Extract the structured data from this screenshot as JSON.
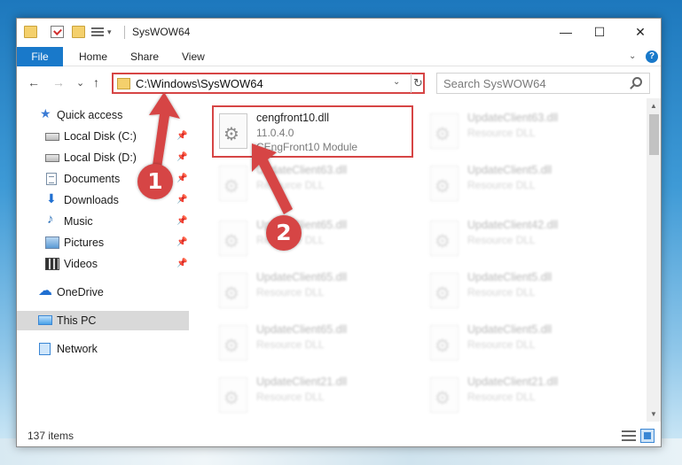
{
  "window": {
    "title": "SysWOW64",
    "controls": {
      "minimize": "—",
      "maximize": "☐",
      "close": "✕"
    }
  },
  "quick_access_toolbar": {
    "items": [
      "folder-icon",
      "properties-icon",
      "new-folder-icon",
      "customize-menu-icon"
    ],
    "dropdown_glyph": "▾"
  },
  "ribbon": {
    "tabs": [
      "File",
      "Home",
      "Share",
      "View"
    ],
    "expand_glyph": "⌄",
    "help_glyph": "?"
  },
  "navigation": {
    "back_glyph": "←",
    "forward_glyph": "→",
    "recent_glyph": "⌄",
    "up_glyph": "↑"
  },
  "address_bar": {
    "path": "C:\\Windows\\SysWOW64",
    "dropdown_glyph": "⌄",
    "refresh_glyph": "↻"
  },
  "search": {
    "placeholder": "Search SysWOW64"
  },
  "nav_pane": {
    "items": [
      {
        "label": "Quick access",
        "icon": "star-icon",
        "pinned": false
      },
      {
        "label": "Local Disk (C:)",
        "icon": "disk-icon",
        "pinned": true
      },
      {
        "label": "Local Disk (D:)",
        "icon": "disk-icon",
        "pinned": true
      },
      {
        "label": "Documents",
        "icon": "documents-icon",
        "pinned": true
      },
      {
        "label": "Downloads",
        "icon": "download-icon",
        "pinned": true
      },
      {
        "label": "Music",
        "icon": "music-icon",
        "pinned": true
      },
      {
        "label": "Pictures",
        "icon": "pictures-icon",
        "pinned": true
      },
      {
        "label": "Videos",
        "icon": "videos-icon",
        "pinned": true
      },
      {
        "label": "OneDrive",
        "icon": "cloud-icon",
        "pinned": false
      },
      {
        "label": "This PC",
        "icon": "computer-icon",
        "pinned": false,
        "selected": true
      },
      {
        "label": "Network",
        "icon": "network-icon",
        "pinned": false
      }
    ],
    "pin_glyph": "📌"
  },
  "files": {
    "highlighted": {
      "name": "cengfront10.dll",
      "version": "11.0.4.0",
      "description": "CEngFront10 Module"
    },
    "blurred": [
      {
        "name": "UpdateClient63.dll",
        "type": "Resource DLL"
      },
      {
        "name": "UpdateClient63.dll",
        "type": "Resource DLL"
      },
      {
        "name": "UpdateClient5.dll",
        "type": "Resource DLL"
      },
      {
        "name": "UpdateClient65.dll",
        "type": "Resource DLL"
      },
      {
        "name": "UpdateClient42.dll",
        "type": "Resource DLL"
      },
      {
        "name": "UpdateClient65.dll",
        "type": "Resource DLL"
      },
      {
        "name": "UpdateClient5.dll",
        "type": "Resource DLL"
      },
      {
        "name": "UpdateClient65.dll",
        "type": "Resource DLL"
      },
      {
        "name": "UpdateClient5.dll",
        "type": "Resource DLL"
      },
      {
        "name": "UpdateClient21.dll",
        "type": "Resource DLL"
      },
      {
        "name": "UpdateClient21.dll",
        "type": "Resource DLL"
      }
    ]
  },
  "status_bar": {
    "item_count": "137 items"
  },
  "annotations": {
    "step1": "1",
    "step2": "2",
    "color": "#d64545"
  },
  "scrollbar": {
    "up_glyph": "▲",
    "down_glyph": "▼"
  }
}
